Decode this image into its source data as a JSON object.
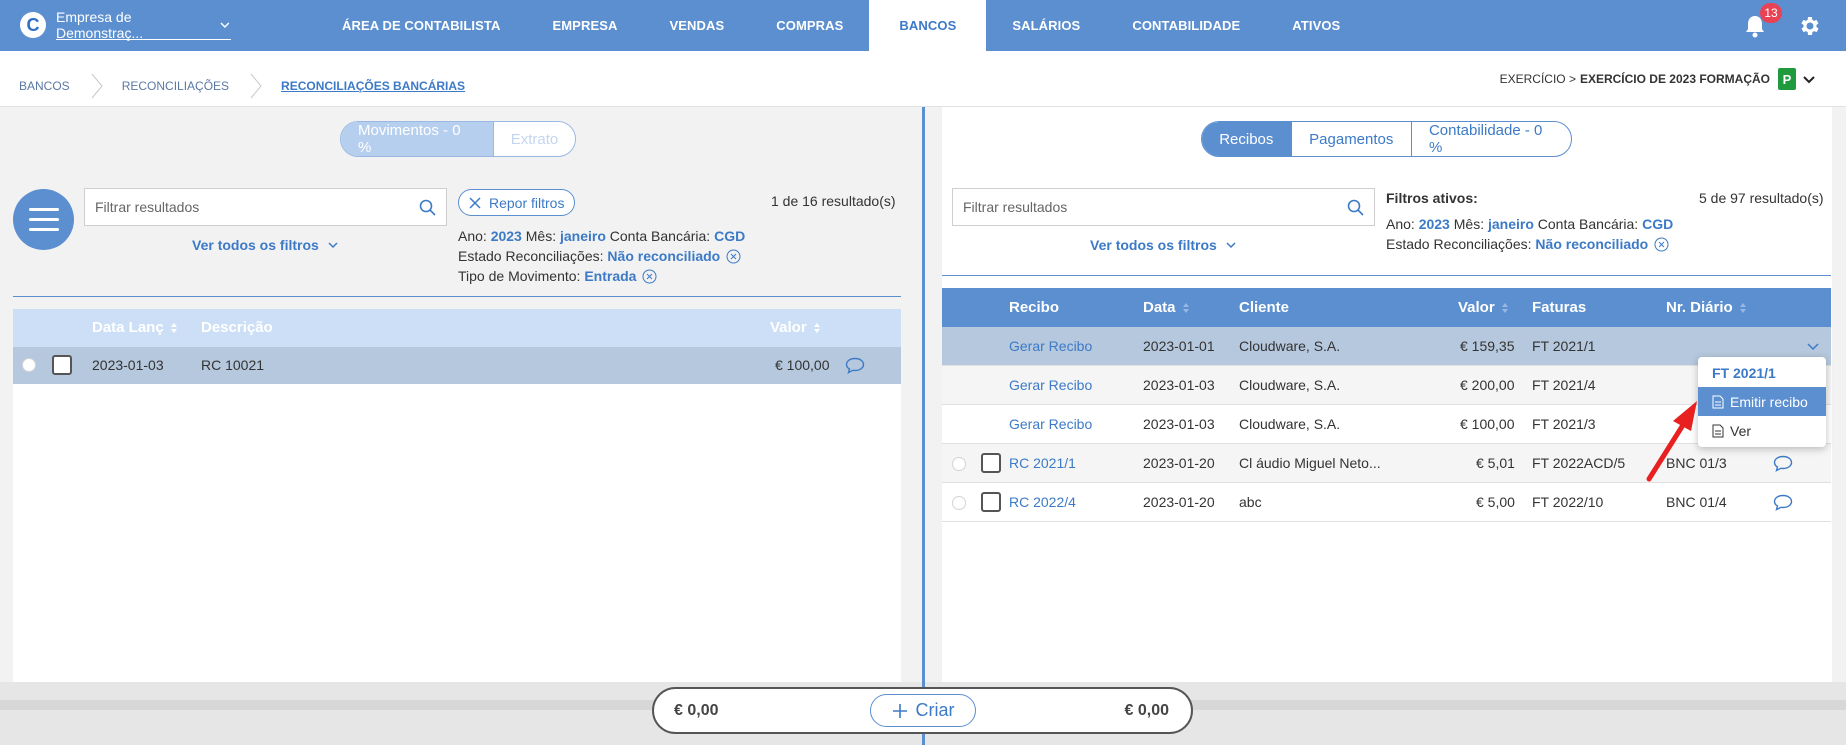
{
  "app": {
    "logo_letter": "C",
    "company": "Empresa de Demonstraç..."
  },
  "nav": {
    "items": [
      "ÁREA DE CONTABILISTA",
      "EMPRESA",
      "VENDAS",
      "COMPRAS",
      "BANCOS",
      "SALÁRIOS",
      "CONTABILIDADE",
      "ATIVOS"
    ],
    "active": "BANCOS",
    "notifications": "13"
  },
  "breadcrumb": {
    "items": [
      "BANCOS",
      "RECONCILIAÇÕES",
      "RECONCILIAÇÕES BANCÁRIAS"
    ]
  },
  "exercise": {
    "label": "EXERCÍCIO >",
    "value": "EXERCÍCIO DE 2023 FORMAÇÃO",
    "badge": "P"
  },
  "left": {
    "tabs": [
      "Movimentos - 0 %",
      "Extrato"
    ],
    "search_placeholder": "Filtrar resultados",
    "see_all": "Ver todos os filtros",
    "reset": "Repor filtros",
    "count": "1 de 16 resultado(s)",
    "filters": {
      "ano_label": "Ano:",
      "ano": "2023",
      "mes_label": "Mês:",
      "mes": "janeiro",
      "conta_label": "Conta Bancária:",
      "conta": "CGD",
      "estado_label": "Estado Reconciliações:",
      "estado": "Não reconciliado",
      "tipo_label": "Tipo de Movimento:",
      "tipo": "Entrada"
    },
    "columns": [
      "Data Lanç",
      "Descrição",
      "Valor"
    ],
    "rows": [
      {
        "date": "2023-01-03",
        "desc": "RC 10021",
        "value": "€ 100,00"
      }
    ]
  },
  "right": {
    "tabs": [
      "Recibos",
      "Pagamentos",
      "Contabilidade - 0 %"
    ],
    "search_placeholder": "Filtrar resultados",
    "see_all": "Ver todos os filtros",
    "active_filters": "Filtros ativos:",
    "count": "5 de 97 resultado(s)",
    "filters": {
      "ano_label": "Ano:",
      "ano": "2023",
      "mes_label": "Mês:",
      "mes": "janeiro",
      "conta_label": "Conta Bancária:",
      "conta": "CGD",
      "estado_label": "Estado Reconciliações:",
      "estado": "Não reconciliado"
    },
    "columns": [
      "Recibo",
      "Data",
      "Cliente",
      "Valor",
      "Faturas",
      "Nr. Diário"
    ],
    "rows": [
      {
        "recibo": "Gerar Recibo",
        "data": "2023-01-01",
        "cliente": "Cloudware, S.A.",
        "valor": "€ 159,35",
        "faturas": "FT 2021/1",
        "diario": ""
      },
      {
        "recibo": "Gerar Recibo",
        "data": "2023-01-03",
        "cliente": "Cloudware, S.A.",
        "valor": "€ 200,00",
        "faturas": "FT 2021/4",
        "diario": ""
      },
      {
        "recibo": "Gerar Recibo",
        "data": "2023-01-03",
        "cliente": "Cloudware, S.A.",
        "valor": "€ 100,00",
        "faturas": "FT 2021/3",
        "diario": ""
      },
      {
        "recibo": "RC 2021/1",
        "data": "2023-01-20",
        "cliente": "Cl áudio Miguel Neto...",
        "valor": "€ 5,01",
        "faturas": "FT 2022ACD/5",
        "diario": "BNC 01/3"
      },
      {
        "recibo": "RC 2022/4",
        "data": "2023-01-20",
        "cliente": "abc",
        "valor": "€ 5,00",
        "faturas": "FT 2022/10",
        "diario": "BNC 01/4"
      }
    ],
    "dropdown": {
      "title": "FT 2021/1",
      "items": [
        "Emitir recibo",
        "Ver"
      ]
    }
  },
  "totals": {
    "left": "€ 0,00",
    "create": "Criar",
    "right": "€ 0,00"
  }
}
